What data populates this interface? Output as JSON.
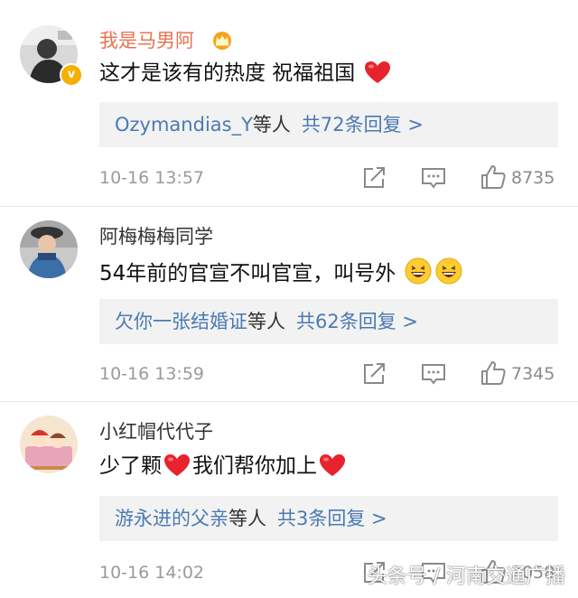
{
  "comments": [
    {
      "username": "我是马男阿",
      "text": "这才是该有的热度 祝福祖国",
      "reply_user": "Ozymandias_Y",
      "reply_etc": "等人",
      "reply_count": "共72条回复 >",
      "time": "10-16 13:57",
      "likes": "8735"
    },
    {
      "username": "阿梅梅梅同学",
      "text": "54年前的官宣不叫官宣，叫号外",
      "reply_user": "欠你一张结婚证",
      "reply_etc": "等人",
      "reply_count": "共62条回复 >",
      "time": "10-16 13:59",
      "likes": "7345"
    },
    {
      "username": "小红帽代代子",
      "text_a": "少了颗",
      "text_b": "我们帮你加上",
      "reply_user": "游永进的父亲",
      "reply_etc": "等人",
      "reply_count": "共3条回复 >",
      "time": "10-16 14:02",
      "likes": "2058"
    }
  ],
  "watermark": "头条号 / 河南交通广播",
  "colors": {
    "vip_name": "#eb7350",
    "link_blue": "#4a7ab3",
    "reply_bg": "#f2f2f2",
    "meta_gray": "#9a9a9a"
  },
  "icons": [
    "verified-badge-icon",
    "vip-crown-icon",
    "heart-emoji-icon",
    "laugh-emoji-icon",
    "share-icon",
    "comment-icon",
    "like-icon"
  ]
}
